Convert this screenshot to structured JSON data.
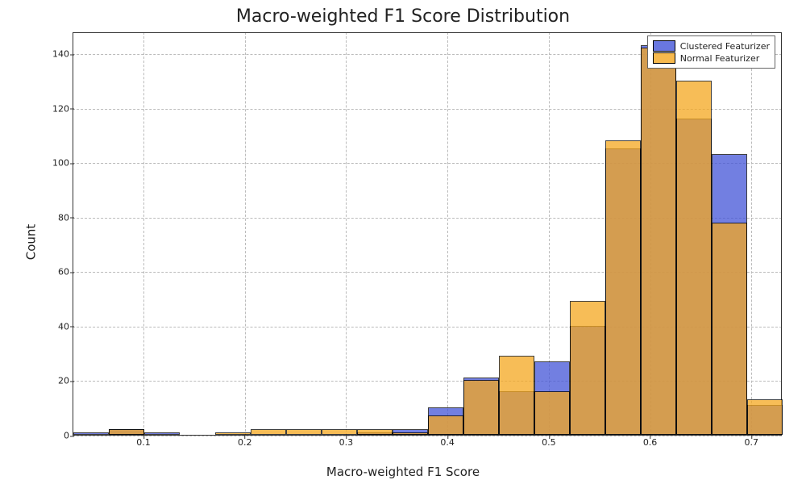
{
  "chart_data": {
    "type": "bar",
    "title": "Macro-weighted F1 Score Distribution",
    "xlabel": "Macro-weighted F1 Score",
    "ylabel": "Count",
    "bin_width": 0.035,
    "bin_edges_left": [
      0.03,
      0.065,
      0.1,
      0.17,
      0.205,
      0.24,
      0.275,
      0.31,
      0.345,
      0.38,
      0.415,
      0.45,
      0.485,
      0.52,
      0.555,
      0.59,
      0.625,
      0.66,
      0.695
    ],
    "series": [
      {
        "name": "Clustered Featurizer",
        "class": "c",
        "values": [
          1,
          2,
          1,
          0,
          0,
          0,
          0,
          1,
          2,
          10,
          21,
          16,
          27,
          40,
          105,
          143,
          116,
          103,
          11
        ]
      },
      {
        "name": "Normal Featurizer",
        "class": "n",
        "values": [
          0,
          2,
          0,
          1,
          2,
          2,
          2,
          2,
          1,
          7,
          20,
          29,
          16,
          49,
          108,
          142,
          130,
          78,
          13
        ]
      }
    ],
    "xlim": [
      0.03,
      0.73
    ],
    "ylim": [
      0,
      148
    ],
    "xticks": [
      0.1,
      0.2,
      0.3,
      0.4,
      0.5,
      0.6,
      0.7
    ],
    "yticks": [
      0,
      20,
      40,
      60,
      80,
      100,
      120,
      140
    ]
  }
}
